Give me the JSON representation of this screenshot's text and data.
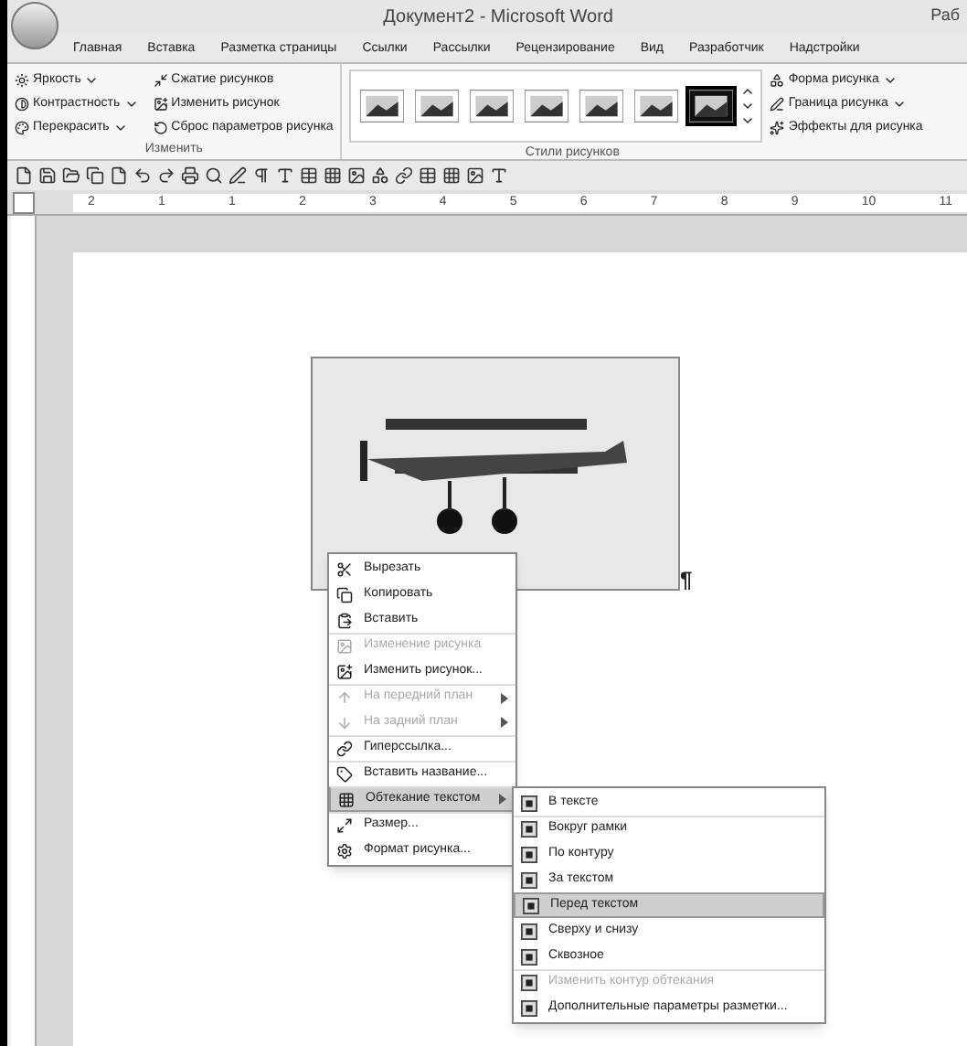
{
  "window": {
    "title": "Документ2 - Microsoft Word",
    "title_right": "Раб"
  },
  "tabs": [
    {
      "label": "Главная"
    },
    {
      "label": "Вставка"
    },
    {
      "label": "Разметка страницы"
    },
    {
      "label": "Ссылки"
    },
    {
      "label": "Рассылки"
    },
    {
      "label": "Рецензирование"
    },
    {
      "label": "Вид"
    },
    {
      "label": "Разработчик"
    },
    {
      "label": "Надстройки"
    }
  ],
  "ribbon": {
    "adjust_group": {
      "label": "Изменить",
      "col1": [
        {
          "label": "Яркость",
          "dropdown": true
        },
        {
          "label": "Контрастность",
          "dropdown": true
        },
        {
          "label": "Перекрасить",
          "dropdown": true
        }
      ],
      "col2": [
        {
          "label": "Сжатие рисунков"
        },
        {
          "label": "Изменить рисунок"
        },
        {
          "label": "Сброс параметров рисунка"
        }
      ]
    },
    "styles_group": {
      "label": "Стили рисунков",
      "thumbnails": [
        {
          "selected": false
        },
        {
          "selected": false
        },
        {
          "selected": false
        },
        {
          "selected": false
        },
        {
          "selected": false
        },
        {
          "selected": false
        },
        {
          "selected": true
        }
      ],
      "side": [
        {
          "label": "Форма рисунка",
          "dropdown": true
        },
        {
          "label": "Граница рисунка",
          "dropdown": true
        },
        {
          "label": "Эффекты для рисунка",
          "dropdown": false
        }
      ]
    }
  },
  "ruler": {
    "labels": [
      "2",
      "1",
      "1",
      "2",
      "3",
      "4",
      "5",
      "6",
      "7",
      "8",
      "9",
      "10",
      "11"
    ]
  },
  "document": {
    "pilcrow": "¶"
  },
  "context_menu": [
    {
      "label": "Вырезать",
      "disabled": false,
      "submenu": false,
      "highlighted": false,
      "separator_before": false
    },
    {
      "label": "Копировать",
      "disabled": false,
      "submenu": false,
      "highlighted": false,
      "separator_before": false
    },
    {
      "label": "Вставить",
      "disabled": false,
      "submenu": false,
      "highlighted": false,
      "separator_before": false
    },
    {
      "label": "Изменение рисунка",
      "disabled": true,
      "submenu": false,
      "highlighted": false,
      "separator_before": true
    },
    {
      "label": "Изменить рисунок...",
      "disabled": false,
      "submenu": false,
      "highlighted": false,
      "separator_before": false
    },
    {
      "label": "На передний план",
      "disabled": true,
      "submenu": true,
      "highlighted": false,
      "separator_before": true
    },
    {
      "label": "На задний план",
      "disabled": true,
      "submenu": true,
      "highlighted": false,
      "separator_before": false
    },
    {
      "label": "Гиперссылка...",
      "disabled": false,
      "submenu": false,
      "highlighted": false,
      "separator_before": true
    },
    {
      "label": "Вставить название...",
      "disabled": false,
      "submenu": false,
      "highlighted": false,
      "separator_before": true
    },
    {
      "label": "Обтекание текстом",
      "disabled": false,
      "submenu": true,
      "highlighted": true,
      "separator_before": true
    },
    {
      "label": "Размер...",
      "disabled": false,
      "submenu": false,
      "highlighted": false,
      "separator_before": true
    },
    {
      "label": "Формат рисунка...",
      "disabled": false,
      "submenu": false,
      "highlighted": false,
      "separator_before": false
    }
  ],
  "wrap_submenu": [
    {
      "label": "В тексте",
      "disabled": false,
      "highlighted": false,
      "separator_before": false
    },
    {
      "label": "Вокруг рамки",
      "disabled": false,
      "highlighted": false,
      "separator_before": true
    },
    {
      "label": "По контуру",
      "disabled": false,
      "highlighted": false,
      "separator_before": false
    },
    {
      "label": "За текстом",
      "disabled": false,
      "highlighted": false,
      "separator_before": false
    },
    {
      "label": "Перед текстом",
      "disabled": false,
      "highlighted": true,
      "separator_before": false
    },
    {
      "label": "Сверху и снизу",
      "disabled": false,
      "highlighted": false,
      "separator_before": false
    },
    {
      "label": "Сквозное",
      "disabled": false,
      "highlighted": false,
      "separator_before": false
    },
    {
      "label": "Изменить контур обтекания",
      "disabled": true,
      "highlighted": false,
      "separator_before": true
    },
    {
      "label": "Дополнительные параметры разметки...",
      "disabled": false,
      "highlighted": false,
      "separator_before": false
    }
  ]
}
